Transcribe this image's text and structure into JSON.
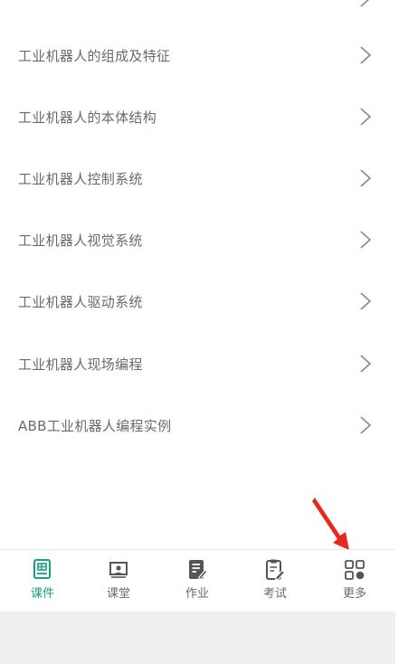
{
  "courses": [
    {
      "label": "工业机器人的组成及特征"
    },
    {
      "label": "工业机器人的本体结构"
    },
    {
      "label": "工业机器人控制系统"
    },
    {
      "label": "工业机器人视觉系统"
    },
    {
      "label": "工业机器人驱动系统"
    },
    {
      "label": "工业机器人现场编程"
    },
    {
      "label": "ABB工业机器人编程实例"
    }
  ],
  "tabs": [
    {
      "label": "课件",
      "icon": "courseware-icon",
      "active": true
    },
    {
      "label": "课堂",
      "icon": "classroom-icon",
      "active": false
    },
    {
      "label": "作业",
      "icon": "homework-icon",
      "active": false
    },
    {
      "label": "考试",
      "icon": "exam-icon",
      "active": false
    },
    {
      "label": "更多",
      "icon": "more-grid-icon",
      "active": false
    }
  ],
  "colors": {
    "accent": "#14a37f",
    "text": "#6a6a6a",
    "icon": "#555555",
    "annotation_arrow": "#e8281d"
  }
}
